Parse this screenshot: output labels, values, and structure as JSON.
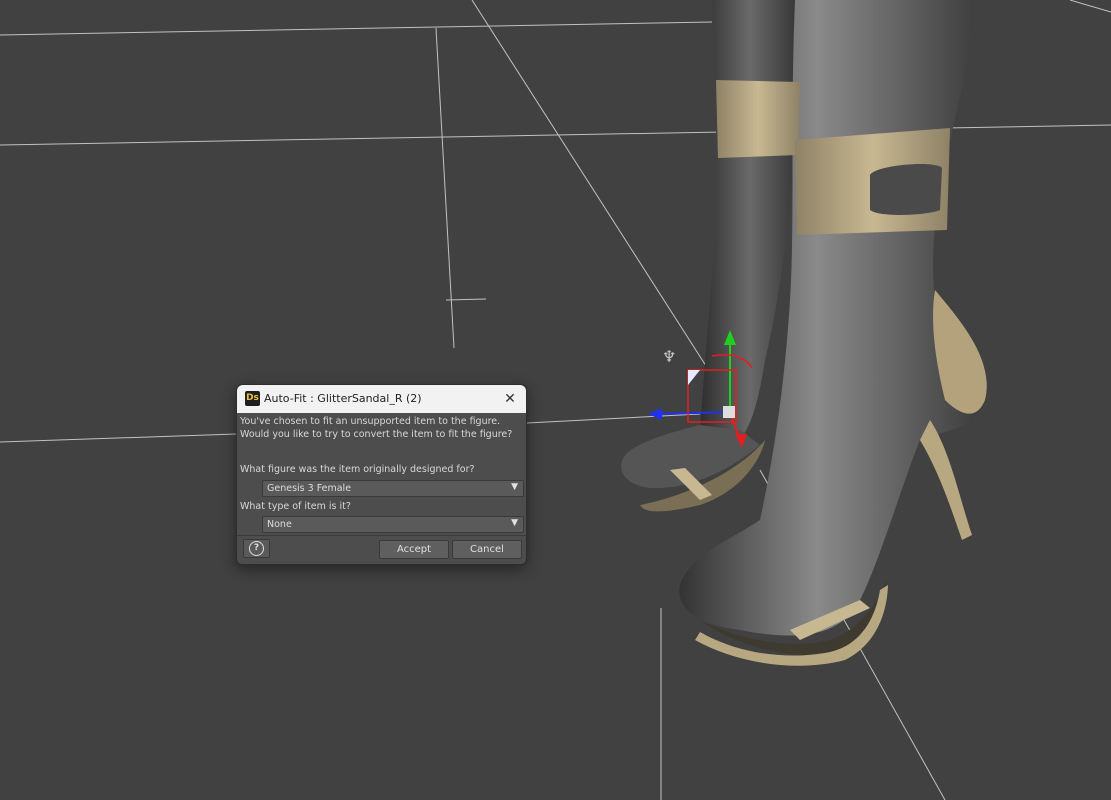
{
  "dialog": {
    "title": "Auto-Fit : GlitterSandal_R (2)",
    "app_icon_text": "Ds",
    "close_glyph": "✕",
    "message_line1": "You've chosen to fit an unsupported item to the figure.",
    "message_line2": "Would you like to try to convert the item to fit the figure?",
    "figure_question": "What figure was the item originally designed for?",
    "figure_select": {
      "selected": "Genesis 3 Female"
    },
    "type_question": "What type of item is it?",
    "type_select": {
      "selected": "None"
    },
    "help_label": "?",
    "accept_label": "Accept",
    "cancel_label": "Cancel"
  },
  "icons": {
    "dropdown": "chevron-down-icon",
    "help": "question-circle-icon",
    "close": "close-icon"
  },
  "colors": {
    "viewport_bg": "#414141",
    "dialog_bg": "#4d4d4d",
    "titlebar_bg": "#f2f2f2",
    "strap_color": "#b8a882",
    "skin_color": "#5a5a5a",
    "gizmo_green": "#1fd11f",
    "gizmo_red": "#e02020",
    "gizmo_blue": "#2030f0"
  }
}
